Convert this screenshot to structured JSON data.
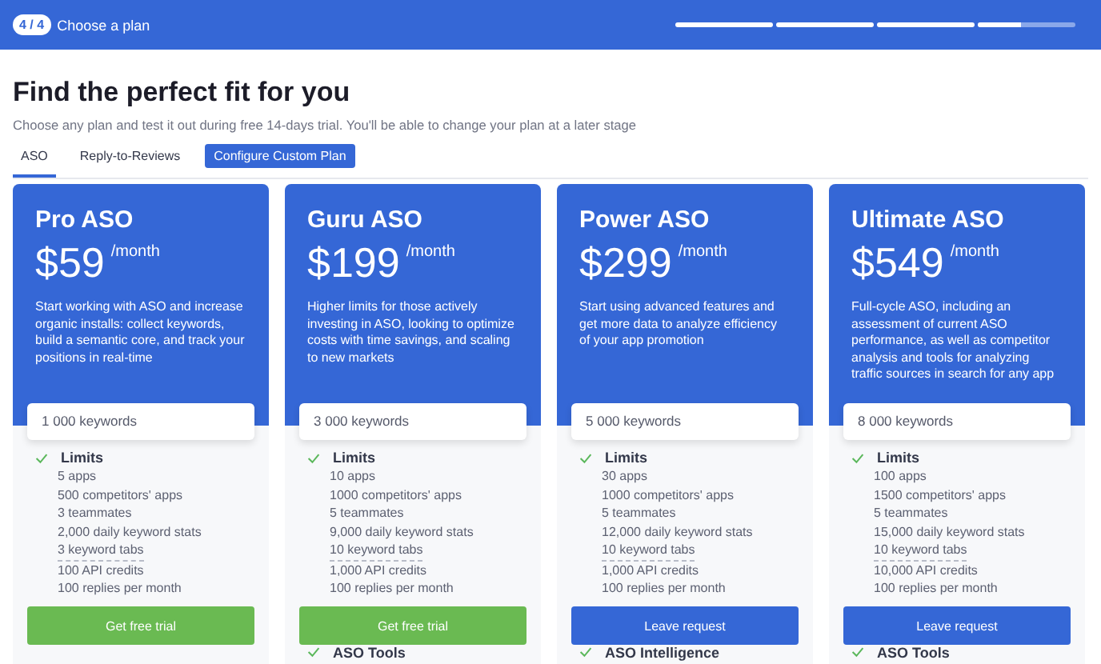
{
  "header": {
    "step": "4 / 4",
    "title": "Choose a plan",
    "progress": [
      {
        "level": 1
      },
      {
        "level": 1
      },
      {
        "level": 1
      },
      {
        "level": 0.45
      }
    ]
  },
  "heading": "Find the perfect fit for you",
  "subtitle": "Choose any plan and test it out during free 14-days trial. You'll be able to change your plan at a later stage",
  "tabs": [
    {
      "label": "ASO",
      "selected": true,
      "kind": "tab"
    },
    {
      "label": "Reply-to-Reviews",
      "selected": false,
      "kind": "tab"
    },
    {
      "label": "Configure Custom Plan",
      "selected": false,
      "kind": "button"
    }
  ],
  "plans": [
    {
      "name": "Pro ASO",
      "price": "$59",
      "period": "/month",
      "description": "Start working with ASO and increase organic installs: collect keywords, build a semantic core, and track your positions in real-time",
      "keywords": "1 000 keywords",
      "section": "Limits",
      "items": [
        {
          "text": "5 apps",
          "hint": false
        },
        {
          "text": "500 competitors' apps",
          "hint": false
        },
        {
          "text": "3 teammates",
          "hint": false
        },
        {
          "text": "2,000 daily keyword stats",
          "hint": false
        },
        {
          "text": "3 keyword tabs",
          "hint": true
        },
        {
          "text": "100 API credits",
          "hint": false
        },
        {
          "text": "100 replies per month",
          "hint": false
        }
      ],
      "action": {
        "label": "Get free trial",
        "kind": "trial"
      }
    },
    {
      "name": "Guru ASO",
      "price": "$199",
      "period": "/month",
      "description": "Higher limits for those actively investing in ASO, looking to optimize costs with time savings, and scaling to new markets",
      "keywords": "3 000 keywords",
      "section": "Limits",
      "items": [
        {
          "text": "10 apps",
          "hint": false
        },
        {
          "text": "1000 competitors' apps",
          "hint": false
        },
        {
          "text": "5 teammates",
          "hint": false
        },
        {
          "text": "9,000 daily keyword stats",
          "hint": false
        },
        {
          "text": "10 keyword tabs",
          "hint": true
        },
        {
          "text": "1,000 API credits",
          "hint": false
        },
        {
          "text": "100 replies per month",
          "hint": false
        }
      ],
      "action": {
        "label": "Get free trial",
        "kind": "trial"
      },
      "next_section": "ASO Tools"
    },
    {
      "name": "Power ASO",
      "price": "$299",
      "period": "/month",
      "description": "Start using advanced features and get more data to analyze efficiency of your app promotion",
      "keywords": "5 000 keywords",
      "section": "Limits",
      "items": [
        {
          "text": "30 apps",
          "hint": false
        },
        {
          "text": "1000 competitors' apps",
          "hint": false
        },
        {
          "text": "5 teammates",
          "hint": false
        },
        {
          "text": "12,000 daily keyword stats",
          "hint": false
        },
        {
          "text": "10 keyword tabs",
          "hint": true
        },
        {
          "text": "1,000 API credits",
          "hint": false
        },
        {
          "text": "100 replies per month",
          "hint": false
        }
      ],
      "action": {
        "label": "Leave request",
        "kind": "request"
      },
      "next_section": "ASO Intelligence"
    },
    {
      "name": "Ultimate ASO",
      "price": "$549",
      "period": "/month",
      "description": "Full-cycle ASO, including an assessment of current ASO performance, as well as competitor analysis and tools for analyzing traffic sources in search for any app",
      "keywords": "8 000 keywords",
      "section": "Limits",
      "items": [
        {
          "text": "100 apps",
          "hint": false
        },
        {
          "text": "1500 competitors' apps",
          "hint": false
        },
        {
          "text": "5 teammates",
          "hint": false
        },
        {
          "text": "15,000 daily keyword stats",
          "hint": false
        },
        {
          "text": "10 keyword tabs",
          "hint": true
        },
        {
          "text": "10,000 API credits",
          "hint": false
        },
        {
          "text": "100 replies per month",
          "hint": false
        }
      ],
      "action": {
        "label": "Leave request",
        "kind": "request"
      },
      "next_section": "ASO Tools"
    }
  ]
}
